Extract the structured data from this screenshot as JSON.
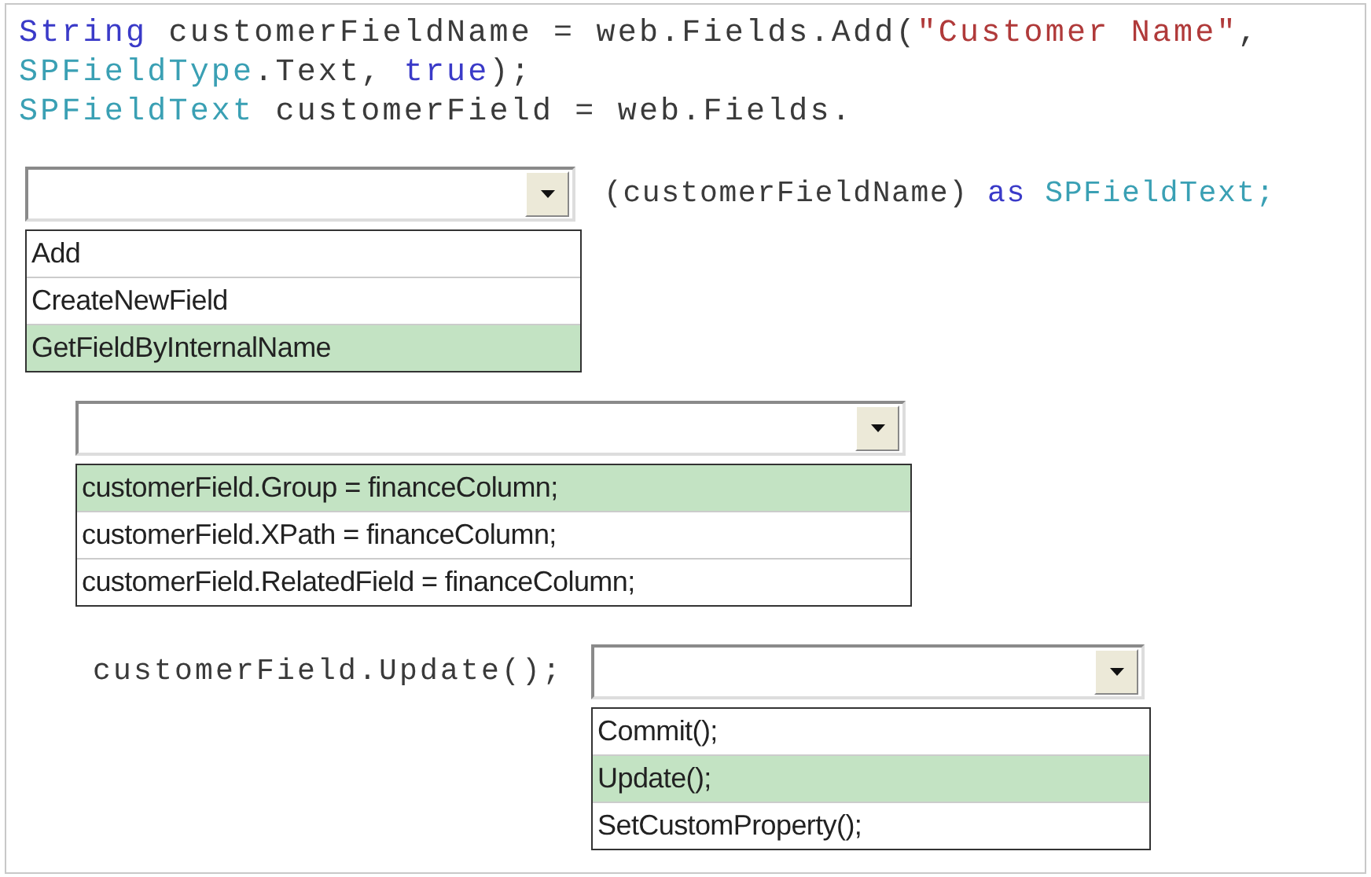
{
  "code_lines": [
    {
      "tokens": [
        {
          "text": "String",
          "kind": "keyword"
        },
        {
          "text": " customerFieldName = web.Fields.Add(",
          "kind": "plain"
        },
        {
          "text": "\"Customer Name\"",
          "kind": "string"
        },
        {
          "text": ",",
          "kind": "plain"
        }
      ]
    },
    {
      "tokens": [
        {
          "text": "SPFieldType",
          "kind": "type"
        },
        {
          "text": ".Text, ",
          "kind": "plain"
        },
        {
          "text": "true",
          "kind": "keyword"
        },
        {
          "text": ");",
          "kind": "plain"
        }
      ]
    },
    {
      "tokens": [
        {
          "text": "SPFieldText",
          "kind": "type"
        },
        {
          "text": " customerField = web.Fields.",
          "kind": "plain"
        }
      ]
    }
  ],
  "dropdowns": [
    {
      "trail_tokens": [
        {
          "text": "(customerFieldName) ",
          "kind": "plain"
        },
        {
          "text": "as",
          "kind": "keyword"
        },
        {
          "text": " SPFieldText;",
          "kind": "type"
        }
      ],
      "options": [
        {
          "label": "Add",
          "selected": false
        },
        {
          "label": "CreateNewField",
          "selected": false
        },
        {
          "label": "GetFieldByInternalName",
          "selected": true
        }
      ]
    },
    {
      "options": [
        {
          "label": "customerField.Group = financeColumn;",
          "selected": true
        },
        {
          "label": "customerField.XPath = financeColumn;",
          "selected": false
        },
        {
          "label": "customerField.RelatedField = financeColumn;",
          "selected": false
        }
      ]
    },
    {
      "lead_text": "customerField.Update();",
      "options": [
        {
          "label": "Commit();",
          "selected": false
        },
        {
          "label": "Update();",
          "selected": true
        },
        {
          "label": "SetCustomProperty();",
          "selected": false
        }
      ]
    }
  ]
}
